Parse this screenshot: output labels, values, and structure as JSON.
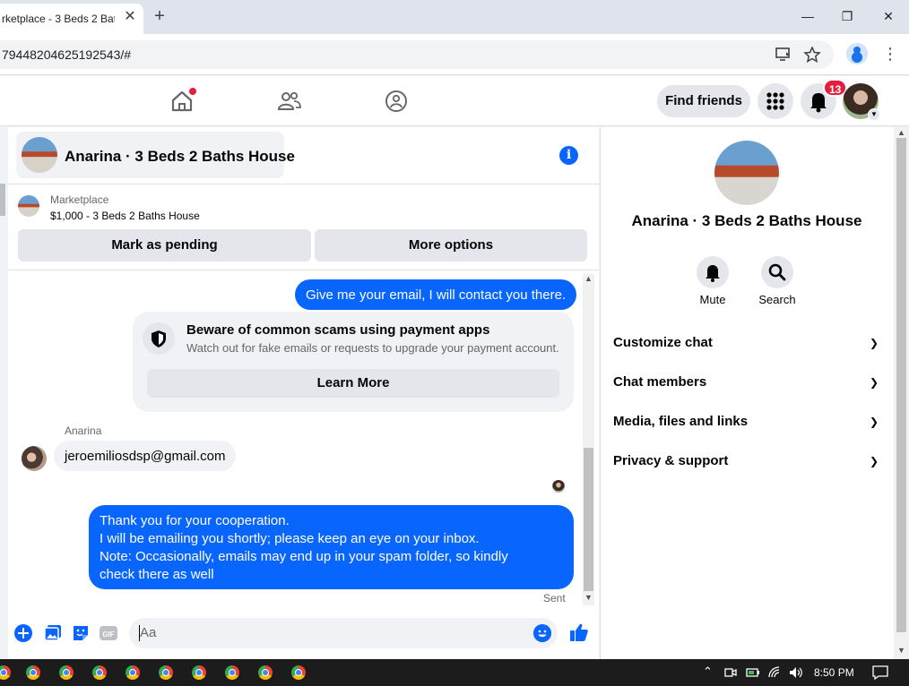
{
  "browser": {
    "tab_title": "rketplace - 3 Beds 2 Bat",
    "tab_close": "✕",
    "new_tab": "+",
    "url": "79448204625192543/#",
    "win_min": "—",
    "win_restore": "❐",
    "win_close": "✕"
  },
  "topnav": {
    "find_friends": "Find friends",
    "notification_count": "13"
  },
  "chat": {
    "header_title": "Anarina · 3 Beds 2 Baths House",
    "marketplace_label": "Marketplace",
    "listing": "$1,000 - 3 Beds 2 Baths House",
    "mark_pending": "Mark as pending",
    "more_options": "More options",
    "messages": [
      {
        "dir": "out",
        "text": "Give me your email, I will contact you there."
      },
      {
        "dir": "in",
        "sender": "Anarina",
        "text": "jeroemiliosdsp@gmail.com"
      },
      {
        "dir": "out",
        "lines": [
          "Thank you for your cooperation.",
          "I will be emailing you shortly; please keep an eye on your inbox.",
          "Note: Occasionally, emails may end up in your spam folder, so kindly",
          "check there as well"
        ]
      }
    ],
    "scam_card": {
      "title": "Beware of common scams using payment apps",
      "body": "Watch out for fake emails or requests to upgrade your payment account.",
      "button": "Learn More"
    },
    "status": "Sent",
    "composer_placeholder": "Aa"
  },
  "info_panel": {
    "name": "Anarina · 3 Beds 2 Baths House",
    "actions": [
      {
        "label": "Mute",
        "icon": "bell-icon"
      },
      {
        "label": "Search",
        "icon": "search-icon"
      }
    ],
    "sections": [
      "Customize chat",
      "Chat members",
      "Media, files and links",
      "Privacy & support"
    ]
  },
  "taskbar": {
    "time": "8:50 PM"
  },
  "colors": {
    "accent": "#0866ff",
    "badge": "#e41e3f",
    "button_gray": "#e4e6eb"
  }
}
